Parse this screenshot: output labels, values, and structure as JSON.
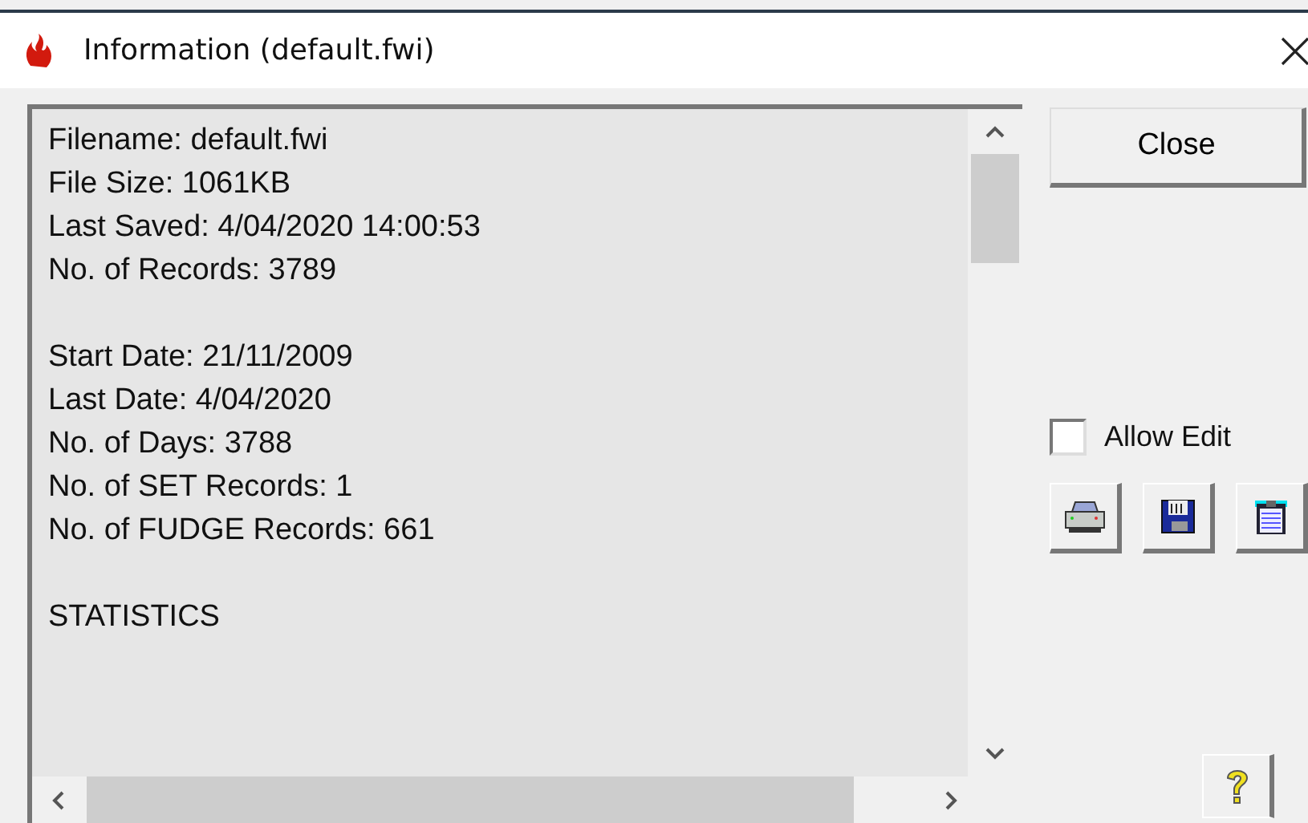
{
  "window": {
    "title": "Information (default.fwi)"
  },
  "info_text": {
    "groups": [
      [
        "Filename: default.fwi",
        "File Size: 1061KB",
        "Last Saved: 4/04/2020 14:00:53",
        "No. of Records: 3789"
      ],
      [
        "Start Date: 21/11/2009",
        "Last Date: 4/04/2020",
        "No. of Days: 3788",
        "No. of SET Records: 1",
        "No. of FUDGE Records: 661"
      ],
      [
        "STATISTICS"
      ]
    ]
  },
  "close_button": "Close",
  "allow_edit": {
    "label": "Allow Edit",
    "checked": false
  }
}
